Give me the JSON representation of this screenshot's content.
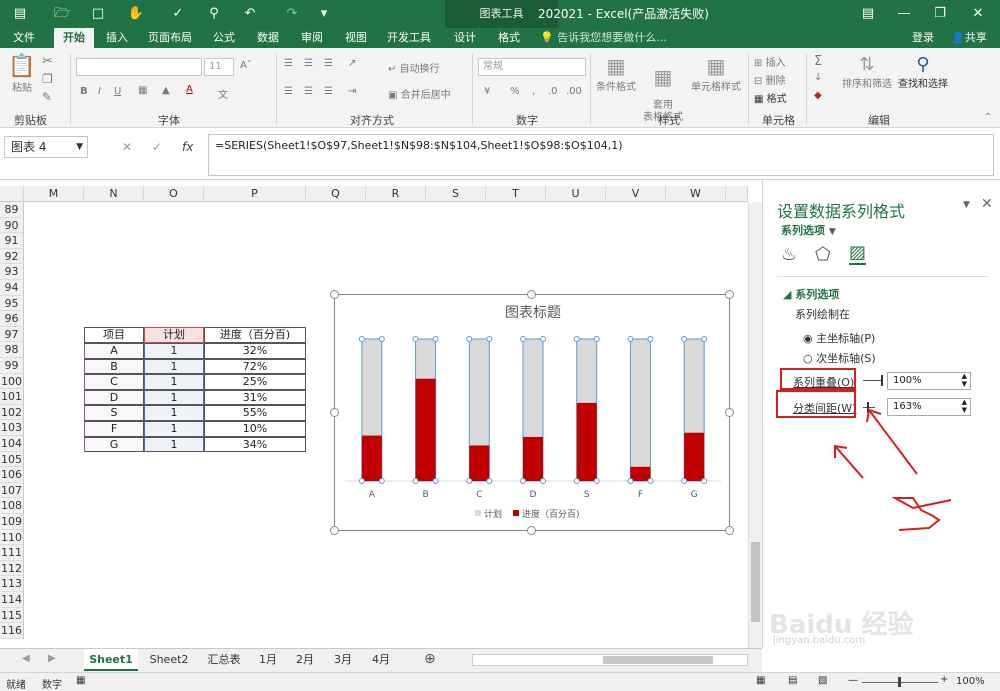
{
  "window": {
    "doc_title": "202021 - Excel(产品激活失败)",
    "context_tab": "图表工具",
    "controls": [
      "minimize-button",
      "maximize-button",
      "close-button"
    ]
  },
  "ribbon_tabs": [
    "文件",
    "开始",
    "插入",
    "页面布局",
    "公式",
    "数据",
    "审阅",
    "视图",
    "开发工具",
    "设计",
    "格式"
  ],
  "tell_me": "告诉我您想要做什么...",
  "signin": "登录",
  "share": "共享",
  "ribbon": {
    "clipboard": {
      "paste": "粘贴",
      "label": "剪贴板"
    },
    "font": {
      "size": "11",
      "label": "字体"
    },
    "alignment": {
      "wrap": "自动换行",
      "merge": "合并后居中",
      "label": "对齐方式"
    },
    "number": {
      "format": "常规",
      "label": "数字"
    },
    "styles": {
      "cond": "条件格式",
      "table": "套用\n表格格式",
      "cell": "单元格样式",
      "label": "样式"
    },
    "cells": {
      "insert": "插入",
      "delete": "删除",
      "format": "格式",
      "label": "单元格"
    },
    "editing": {
      "sort": "排序和筛选",
      "find": "查找和选择",
      "label": "编辑"
    }
  },
  "formula_bar": {
    "name_box": "图表 4",
    "formula": "=SERIES(Sheet1!$O$97,Sheet1!$N$98:$N$104,Sheet1!$O$98:$O$104,1)"
  },
  "columns": [
    "M",
    "N",
    "O",
    "P",
    "Q",
    "R",
    "S",
    "T",
    "U",
    "V",
    "W"
  ],
  "rows": [
    "89",
    "90",
    "91",
    "92",
    "93",
    "94",
    "95",
    "96",
    "97",
    "98",
    "99",
    "100",
    "101",
    "102",
    "103",
    "104",
    "105",
    "106",
    "107",
    "108",
    "109",
    "110",
    "111",
    "112",
    "113",
    "114",
    "115",
    "116"
  ],
  "table": {
    "headers": [
      "项目",
      "计划",
      "进度（百分百)"
    ],
    "rows": [
      [
        "A",
        "1",
        "32%"
      ],
      [
        "B",
        "1",
        "72%"
      ],
      [
        "C",
        "1",
        "25%"
      ],
      [
        "D",
        "1",
        "31%"
      ],
      [
        "S",
        "1",
        "55%"
      ],
      [
        "F",
        "1",
        "10%"
      ],
      [
        "G",
        "1",
        "34%"
      ]
    ]
  },
  "chart_data": {
    "type": "bar",
    "title": "图表标题",
    "categories": [
      "A",
      "B",
      "C",
      "D",
      "S",
      "F",
      "G"
    ],
    "series": [
      {
        "name": "计划",
        "values": [
          1,
          1,
          1,
          1,
          1,
          1,
          1
        ],
        "color": "#d9d9d9"
      },
      {
        "name": "进度（百分百)",
        "values": [
          0.32,
          0.72,
          0.25,
          0.31,
          0.55,
          0.1,
          0.34
        ],
        "color": "#c00000"
      }
    ],
    "ylim": [
      0,
      1
    ],
    "legend": "bottom",
    "grid": false,
    "overlap": "100%",
    "gap_width": "163%"
  },
  "panel": {
    "title": "设置数据系列格式",
    "subtitle": "系列选项",
    "section": "系列选项",
    "plot_on": "系列绘制在",
    "primary": "主坐标轴(P)",
    "secondary": "次坐标轴(S)",
    "overlap_label": "系列重叠(O)",
    "overlap_value": "100%",
    "gap_label": "分类间距(W)",
    "gap_value": "163%",
    "annotation": "5"
  },
  "sheet_tabs": [
    "Sheet1",
    "Sheet2",
    "汇总表",
    "1月",
    "2月",
    "3月",
    "4月"
  ],
  "status": {
    "ready": "就绪",
    "mode": "数字",
    "zoom": "100%"
  },
  "watermark": {
    "brand": "Baidu 经验",
    "url": "jingyan.baidu.com"
  }
}
